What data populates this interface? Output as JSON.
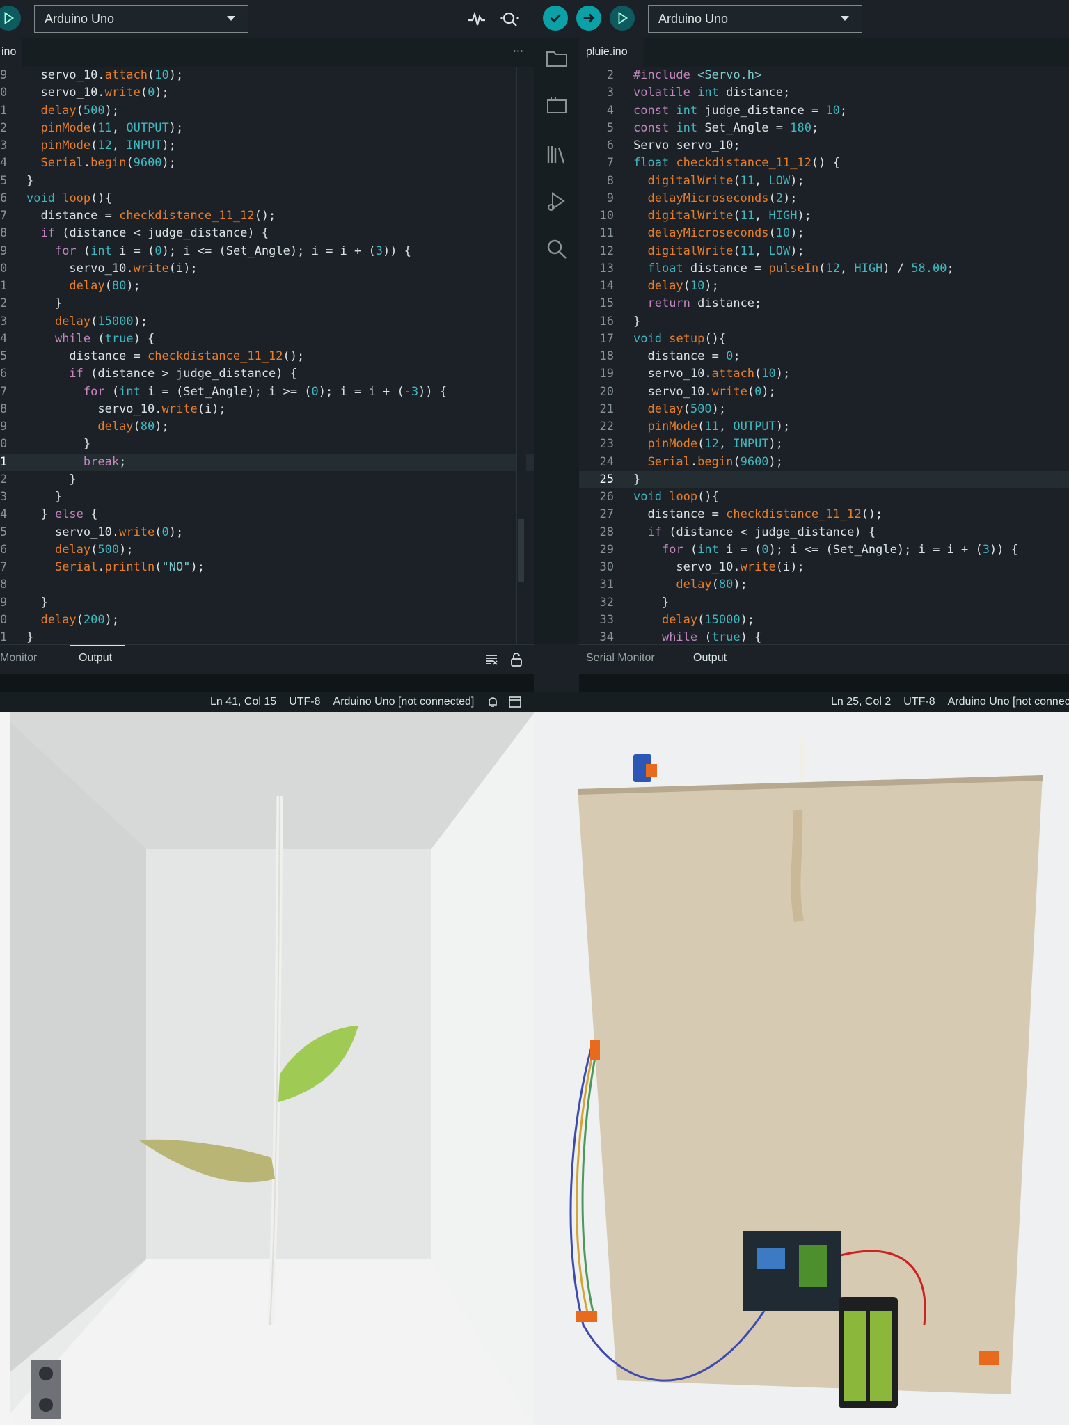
{
  "left_ide": {
    "board": "Arduino Uno",
    "file_tab": "ino",
    "more_label": "···",
    "code_lines": [
      {
        "num": "9",
        "text": "  servo_10.attach(10);"
      },
      {
        "num": "0",
        "text": "  servo_10.write(0);"
      },
      {
        "num": "1",
        "text": "  delay(500);"
      },
      {
        "num": "2",
        "text": "  pinMode(11, OUTPUT);"
      },
      {
        "num": "3",
        "text": "  pinMode(12, INPUT);"
      },
      {
        "num": "4",
        "text": "  Serial.begin(9600);"
      },
      {
        "num": "5",
        "text": "}"
      },
      {
        "num": "6",
        "text": "void loop(){"
      },
      {
        "num": "7",
        "text": "  distance = checkdistance_11_12();"
      },
      {
        "num": "8",
        "text": "  if (distance < judge_distance) {"
      },
      {
        "num": "9",
        "text": "    for (int i = (0); i <= (Set_Angle); i = i + (3)) {"
      },
      {
        "num": "0",
        "text": "      servo_10.write(i);"
      },
      {
        "num": "1",
        "text": "      delay(80);"
      },
      {
        "num": "2",
        "text": "    }"
      },
      {
        "num": "3",
        "text": "    delay(15000);"
      },
      {
        "num": "4",
        "text": "    while (true) {"
      },
      {
        "num": "5",
        "text": "      distance = checkdistance_11_12();"
      },
      {
        "num": "6",
        "text": "      if (distance > judge_distance) {"
      },
      {
        "num": "7",
        "text": "        for (int i = (Set_Angle); i >= (0); i = i + (-3)) {"
      },
      {
        "num": "8",
        "text": "          servo_10.write(i);"
      },
      {
        "num": "9",
        "text": "          delay(80);"
      },
      {
        "num": "0",
        "text": "        }"
      },
      {
        "num": "1",
        "text": "        break;"
      },
      {
        "num": "2",
        "text": "      }"
      },
      {
        "num": "3",
        "text": "    }"
      },
      {
        "num": "4",
        "text": "  } else {"
      },
      {
        "num": "5",
        "text": "    servo_10.write(0);"
      },
      {
        "num": "6",
        "text": "    delay(500);"
      },
      {
        "num": "7",
        "text": "    Serial.println(\"NO\");"
      },
      {
        "num": "8",
        "text": ""
      },
      {
        "num": "9",
        "text": "  }"
      },
      {
        "num": "0",
        "text": "  delay(200);"
      },
      {
        "num": "1",
        "text": "}"
      }
    ],
    "panel_tabs": [
      "l Monitor",
      "Output"
    ],
    "status": [
      "Ln 41, Col 15",
      "UTF-8",
      "Arduino Uno [not connected]"
    ]
  },
  "right_ide": {
    "board": "Arduino Uno",
    "file_tab": "pluie.ino",
    "code_lines": [
      {
        "num": "2",
        "text": "#include <Servo.h>"
      },
      {
        "num": "3",
        "text": "volatile int distance;"
      },
      {
        "num": "4",
        "text": "const int judge_distance = 10;"
      },
      {
        "num": "5",
        "text": "const int Set_Angle = 180;"
      },
      {
        "num": "6",
        "text": "Servo servo_10;"
      },
      {
        "num": "7",
        "text": "float checkdistance_11_12() {"
      },
      {
        "num": "8",
        "text": "  digitalWrite(11, LOW);"
      },
      {
        "num": "9",
        "text": "  delayMicroseconds(2);"
      },
      {
        "num": "10",
        "text": "  digitalWrite(11, HIGH);"
      },
      {
        "num": "11",
        "text": "  delayMicroseconds(10);"
      },
      {
        "num": "12",
        "text": "  digitalWrite(11, LOW);"
      },
      {
        "num": "13",
        "text": "  float distance = pulseIn(12, HIGH) / 58.00;"
      },
      {
        "num": "14",
        "text": "  delay(10);"
      },
      {
        "num": "15",
        "text": "  return distance;"
      },
      {
        "num": "16",
        "text": "}"
      },
      {
        "num": "17",
        "text": "void setup(){"
      },
      {
        "num": "18",
        "text": "  distance = 0;"
      },
      {
        "num": "19",
        "text": "  servo_10.attach(10);"
      },
      {
        "num": "20",
        "text": "  servo_10.write(0);"
      },
      {
        "num": "21",
        "text": "  delay(500);"
      },
      {
        "num": "22",
        "text": "  pinMode(11, OUTPUT);"
      },
      {
        "num": "23",
        "text": "  pinMode(12, INPUT);"
      },
      {
        "num": "24",
        "text": "  Serial.begin(9600);"
      },
      {
        "num": "25",
        "text": "}"
      },
      {
        "num": "26",
        "text": "void loop(){"
      },
      {
        "num": "27",
        "text": "  distance = checkdistance_11_12();"
      },
      {
        "num": "28",
        "text": "  if (distance < judge_distance) {"
      },
      {
        "num": "29",
        "text": "    for (int i = (0); i <= (Set_Angle); i = i + (3)) {"
      },
      {
        "num": "30",
        "text": "      servo_10.write(i);"
      },
      {
        "num": "31",
        "text": "      delay(80);"
      },
      {
        "num": "32",
        "text": "    }"
      },
      {
        "num": "33",
        "text": "    delay(15000);"
      },
      {
        "num": "34",
        "text": "    while (true) {"
      }
    ],
    "panel_tabs": [
      "Serial Monitor",
      "Output"
    ],
    "status": [
      "Ln 25, Col 2",
      "UTF-8",
      "Arduino Uno [not connect"
    ]
  },
  "colors": {
    "editor_bg": "#1b2126",
    "accent_teal": "#0ca1a6",
    "keyword": "#c586c0",
    "function": "#e97e28",
    "number": "#3fb8c0"
  },
  "icons": {
    "verify": "check-icon",
    "upload": "arrow-right-icon",
    "debug": "debug-icon",
    "plotter": "serial-plotter-icon",
    "monitor": "serial-monitor-icon",
    "sidebar": [
      "folder-icon",
      "board-manager-icon",
      "library-icon",
      "debug-icon",
      "search-icon"
    ]
  }
}
